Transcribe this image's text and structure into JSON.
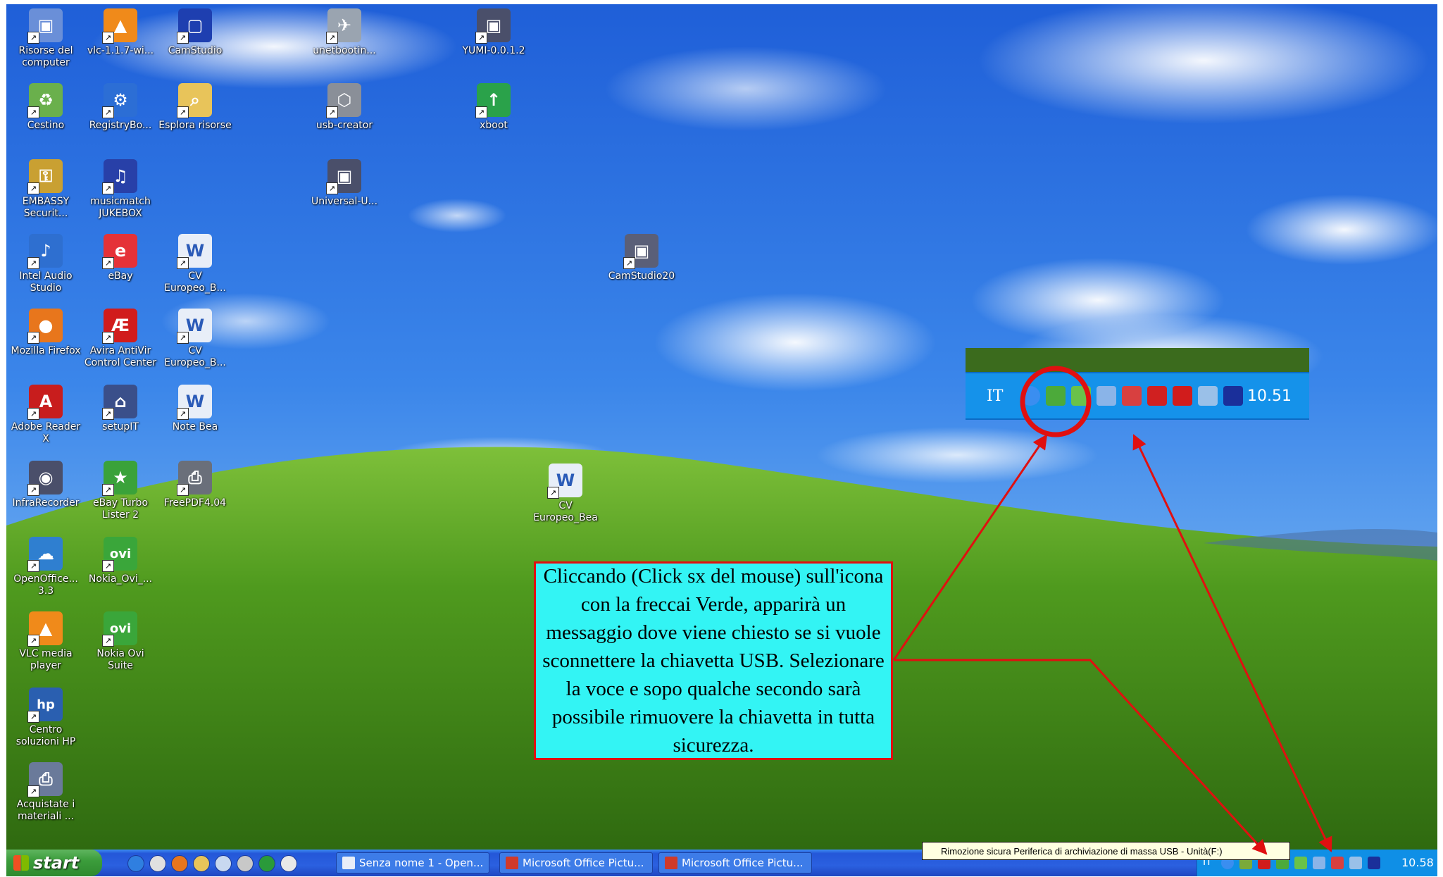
{
  "desktop": {
    "icons": [
      {
        "label": "Risorse del computer",
        "icon": "computer-icon",
        "color": "#6a8fd8"
      },
      {
        "label": "vlc-1.1.7-wi...",
        "icon": "vlc-icon",
        "color": "#f08a1a"
      },
      {
        "label": "CamStudio",
        "icon": "camstudio-icon",
        "color": "#1e3fb0"
      },
      {
        "label": "unetbootin...",
        "icon": "rocket-icon",
        "color": "#9aa4b0"
      },
      {
        "label": "YUMI-0.0.1.2",
        "icon": "yumi-icon",
        "color": "#4a4f6a"
      },
      {
        "label": "Cestino",
        "icon": "recycle-bin-icon",
        "color": "#6ab04c"
      },
      {
        "label": "RegistryBo...",
        "icon": "registry-icon",
        "color": "#2c6ed5"
      },
      {
        "label": "Esplora risorse",
        "icon": "explorer-icon",
        "color": "#e8c45a"
      },
      {
        "label": "usb-creator",
        "icon": "usb-creator-icon",
        "color": "#8a8f98"
      },
      {
        "label": "xboot",
        "icon": "xboot-icon",
        "color": "#2aa24a"
      },
      {
        "label": "EMBASSY Securit...",
        "icon": "lock-icon",
        "color": "#c9a032"
      },
      {
        "label": "musicmatch JUKEBOX",
        "icon": "musicmatch-icon",
        "color": "#2840a8"
      },
      {
        "label": "Universal-U...",
        "icon": "universal-usb-icon",
        "color": "#4a4f6a"
      },
      {
        "label": "Intel Audio Studio",
        "icon": "speaker-icon",
        "color": "#2e6fd0"
      },
      {
        "label": "eBay",
        "icon": "ebay-icon",
        "color": "#e53238"
      },
      {
        "label": "CV Europeo_B...",
        "icon": "word-doc-icon",
        "color": "#e8eef8"
      },
      {
        "label": "CamStudio20",
        "icon": "camstudio20-icon",
        "color": "#5a5f78"
      },
      {
        "label": "Mozilla Firefox",
        "icon": "firefox-icon",
        "color": "#e8761c"
      },
      {
        "label": "Avira AntiVir Control Center",
        "icon": "avira-icon",
        "color": "#d11c1c"
      },
      {
        "label": "CV Europeo_B...",
        "icon": "word-doc-icon",
        "color": "#e8eef8"
      },
      {
        "label": "Adobe Reader X",
        "icon": "adobe-reader-icon",
        "color": "#c81d1d"
      },
      {
        "label": "setupIT",
        "icon": "setup-icon",
        "color": "#3a4f8a"
      },
      {
        "label": "Note Bea",
        "icon": "word-doc-icon",
        "color": "#e8eef8"
      },
      {
        "label": "InfraRecorder",
        "icon": "infrarecorder-icon",
        "color": "#4a4f6a"
      },
      {
        "label": "eBay Turbo Lister 2",
        "icon": "turbo-lister-icon",
        "color": "#3aa23a"
      },
      {
        "label": "FreePDF4.04",
        "icon": "freepdf-icon",
        "color": "#6a6f7a"
      },
      {
        "label": "CV Europeo_Bea",
        "icon": "word-doc-icon",
        "color": "#e8eef8"
      },
      {
        "label": "OpenOffice... 3.3",
        "icon": "openoffice-icon",
        "color": "#2f7fd0"
      },
      {
        "label": "Nokia_Ovi_...",
        "icon": "ovi-icon",
        "color": "#3aa63a"
      },
      {
        "label": "VLC media player",
        "icon": "vlc-icon",
        "color": "#f08a1a"
      },
      {
        "label": "Nokia Ovi Suite",
        "icon": "ovi-icon",
        "color": "#3aa63a"
      },
      {
        "label": "Centro soluzioni HP",
        "icon": "hp-icon",
        "color": "#2a5fb0"
      },
      {
        "label": "Acquistate i materiali ...",
        "icon": "printer-icon",
        "color": "#6a7a9a"
      }
    ]
  },
  "zoom": {
    "lang": "IT",
    "clock": "10.51",
    "icons": [
      {
        "icon": "chevron-left-icon",
        "color": "#3a8ef0"
      },
      {
        "icon": "safely-remove-icon",
        "color": "#4caa3a"
      },
      {
        "icon": "network-icon",
        "color": "#6ac24a"
      },
      {
        "icon": "monitor-icon",
        "color": "#8ab4e8"
      },
      {
        "icon": "disconnected-icon",
        "color": "#d84040"
      },
      {
        "icon": "shield-icon",
        "color": "#d02020"
      },
      {
        "icon": "avira-tray-icon",
        "color": "#d11c1c"
      },
      {
        "icon": "graph-icon",
        "color": "#9ac0e8"
      },
      {
        "icon": "app-tray-icon",
        "color": "#1a2f9a"
      }
    ]
  },
  "callout": {
    "text": "Cliccando (Click sx del mouse) sull'icona con la freccai Verde, apparirà un messaggio dove viene chiesto se si vuole sconnettere la chiavetta USB. Selezionare la voce e sopo qualche secondo sarà possibile rimuovere la chiavetta in tutta sicurezza."
  },
  "tooltip": "Rimozione sicura Periferica di archiviazione di massa USB - Unità(F:)",
  "taskbar": {
    "start_label": "start",
    "quicklaunch": [
      {
        "icon": "internet-explorer-icon",
        "color": "#2f7fe0"
      },
      {
        "icon": "chrome-icon",
        "color": "#e0e0e0"
      },
      {
        "icon": "firefox-icon",
        "color": "#e8761c"
      },
      {
        "icon": "folder-icon",
        "color": "#e8c45a"
      },
      {
        "icon": "sync-icon",
        "color": "#c8d8f0"
      },
      {
        "icon": "media-icon",
        "color": "#c8c8c8"
      },
      {
        "icon": "excel-icon",
        "color": "#2a9a3a"
      },
      {
        "icon": "disc-icon",
        "color": "#e8e8e8"
      }
    ],
    "tasks": [
      {
        "label": "Senza nome 1 - Open...",
        "icon": "openoffice-doc-icon",
        "color": "#e8eef8"
      },
      {
        "label": "Microsoft Office Pictu...",
        "icon": "picture-manager-icon",
        "color": "#d03a2a"
      },
      {
        "label": "Microsoft Office Pictu...",
        "icon": "picture-manager-icon",
        "color": "#d03a2a"
      }
    ],
    "tray": {
      "lang": "IT",
      "clock": "10.58",
      "icons": [
        {
          "icon": "chevron-left-icon",
          "color": "#3a8ef0"
        },
        {
          "icon": "graph-icon",
          "color": "#7aaa3a"
        },
        {
          "icon": "avira-tray-icon",
          "color": "#d11c1c"
        },
        {
          "icon": "safely-remove-icon",
          "color": "#4caa3a"
        },
        {
          "icon": "network-icon",
          "color": "#6ac24a"
        },
        {
          "icon": "monitor-icon",
          "color": "#8ab4e8"
        },
        {
          "icon": "disconnected-icon",
          "color": "#d84040"
        },
        {
          "icon": "graph-icon",
          "color": "#9ac0e8"
        },
        {
          "icon": "app-tray-icon",
          "color": "#1a2f9a"
        }
      ]
    }
  }
}
